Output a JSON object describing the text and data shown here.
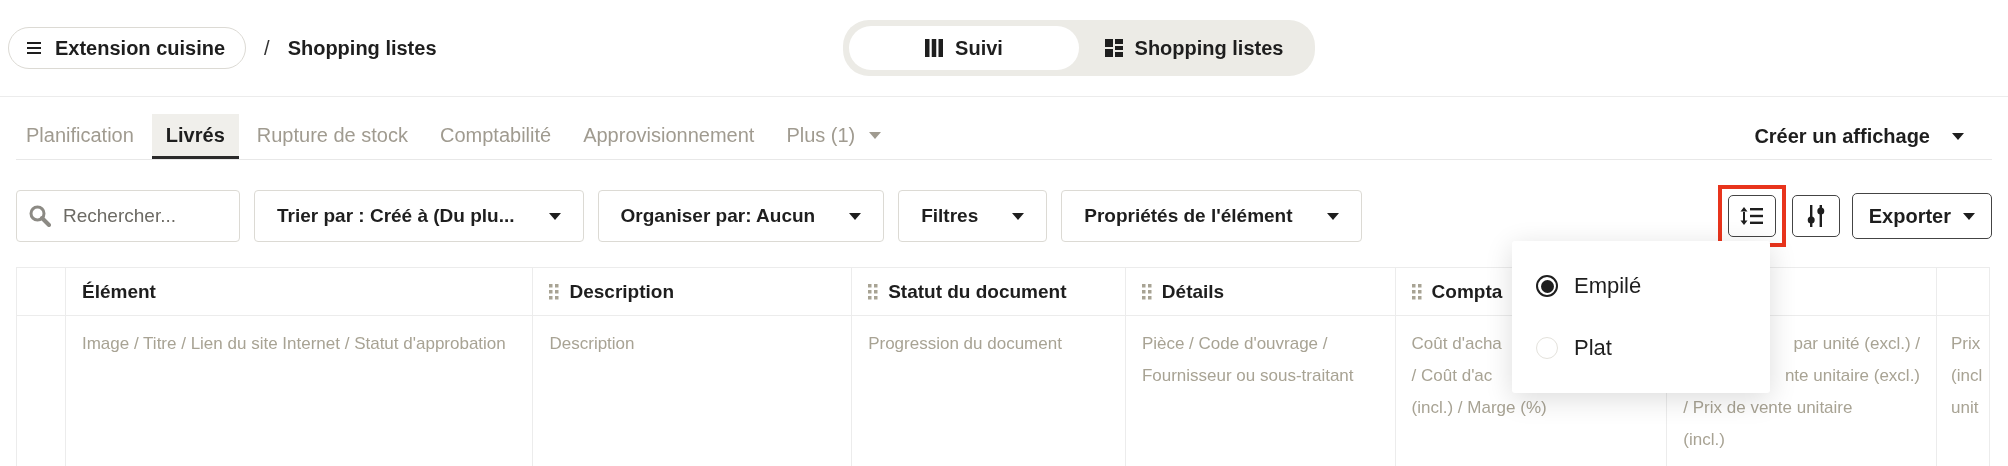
{
  "breadcrumb": {
    "menu_label": "Extension cuisine",
    "separator": "/",
    "current": "Shopping listes"
  },
  "view_switch": [
    {
      "label": "Suivi",
      "selected": true
    },
    {
      "label": "Shopping listes",
      "selected": false
    }
  ],
  "tabs": [
    {
      "label": "Planification",
      "selected": false,
      "kind": "tab"
    },
    {
      "label": "Livrés",
      "selected": true,
      "kind": "tab"
    },
    {
      "label": "Rupture de stock",
      "selected": false,
      "kind": "tab"
    },
    {
      "label": "Comptabilité",
      "selected": false,
      "kind": "tab"
    },
    {
      "label": "Approvisionnement",
      "selected": false,
      "kind": "tab"
    },
    {
      "label": "Plus (1)",
      "selected": false,
      "kind": "dropdown"
    }
  ],
  "create_view": "Créer un affichage",
  "toolbar": {
    "search_placeholder": "Rechercher...",
    "dropdowns": [
      "Trier par : Créé à (Du plu...",
      "Organiser par: Aucun",
      "Filtres",
      "Propriétés de l'élément"
    ],
    "density_button": {
      "highlighted": true
    },
    "export": "Exporter"
  },
  "density_menu": {
    "options": [
      {
        "label": "Empilé",
        "selected": true
      },
      {
        "label": "Plat",
        "selected": false
      }
    ]
  },
  "table": {
    "columns": [
      {
        "kind": "blank"
      },
      {
        "kind": "text",
        "label": "Élément",
        "draggable": false
      },
      {
        "kind": "text",
        "label": "Description",
        "draggable": true
      },
      {
        "kind": "text",
        "label": "Statut du document",
        "draggable": true
      },
      {
        "kind": "text",
        "label": "Détails",
        "draggable": true
      },
      {
        "kind": "text",
        "label": "Compta",
        "draggable": true
      },
      {
        "kind": "blank"
      },
      {
        "kind": "blank"
      }
    ],
    "row": [
      {
        "kind": "blank"
      },
      {
        "kind": "text",
        "text": "Image / Titre / Lien du site Internet / Statut d'approbation"
      },
      {
        "kind": "text",
        "text": "Description"
      },
      {
        "kind": "text",
        "text": "Progression du document"
      },
      {
        "kind": "text",
        "text": "Pièce / Code d'ouvrage / Fournisseur ou sous-traitant"
      },
      {
        "kind": "lines",
        "lines": [
          {
            "text": "Coût d'acha"
          },
          {
            "text": "/ Coût d'ac"
          },
          {
            "text": "(incl.) / Marge (%)"
          }
        ]
      },
      {
        "kind": "lines",
        "lines": [
          {
            "text": "par unité (excl.) /",
            "covered": true
          },
          {
            "text": "nte unitaire (excl.)",
            "covered": true
          },
          {
            "text": "/ Prix de vente unitaire",
            "covered": false
          },
          {
            "text": "(incl.)",
            "covered": false
          }
        ]
      },
      {
        "kind": "lines",
        "lines": [
          {
            "text": "Prix"
          },
          {
            "text": "(incl"
          },
          {
            "text": "unit"
          }
        ]
      }
    ]
  }
}
